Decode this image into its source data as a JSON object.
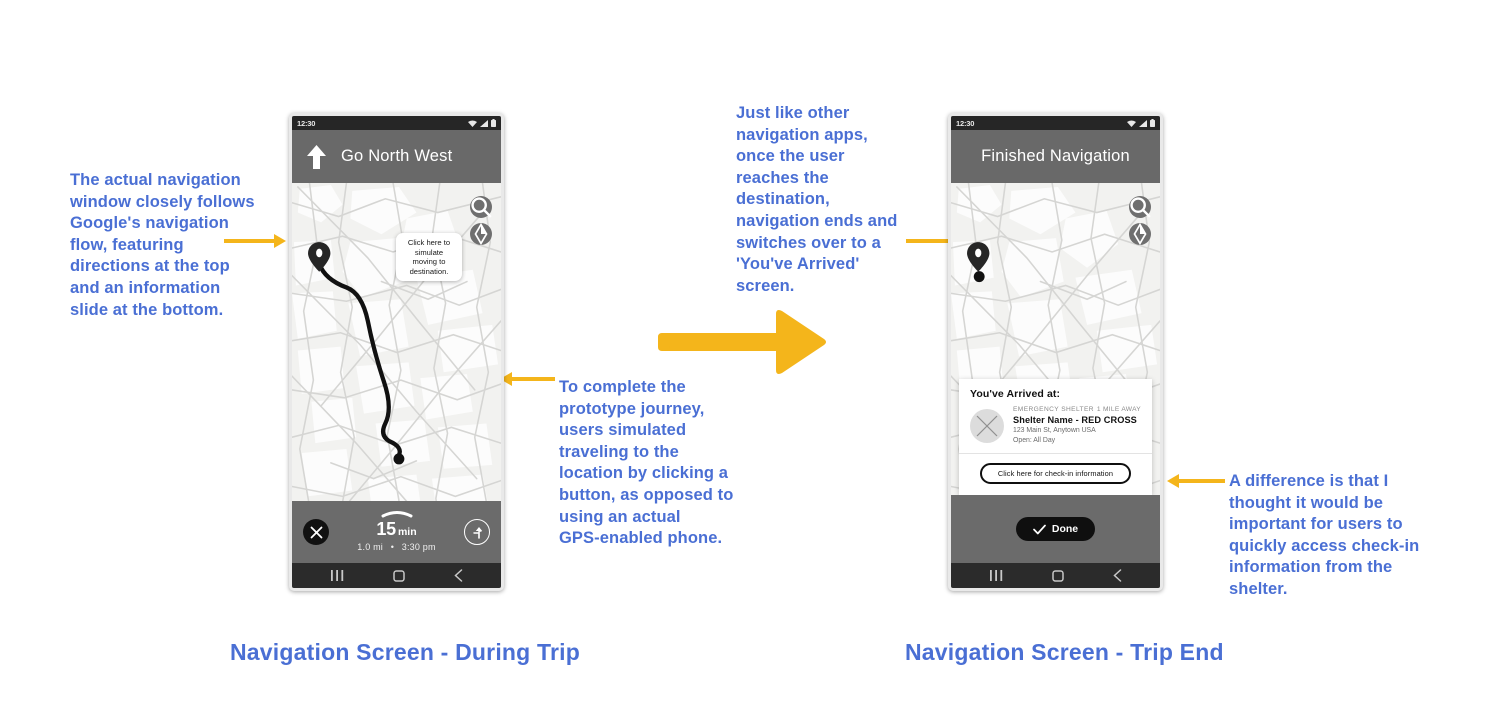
{
  "colors": {
    "annotation_blue": "#4a6fd4",
    "arrow_yellow": "#F4B51B",
    "app_bar_gray": "#696969",
    "status_bar": "#262626",
    "map_bg": "#f2f2f0",
    "route_black": "#111111"
  },
  "annotations": [
    {
      "id": "left-note",
      "text": "The actual navigation\nwindow closely follows\nGoogle's navigation\nflow, featuring\ndirections at the top\nand an information\nslide at the bottom."
    },
    {
      "id": "center-note",
      "text": "Just like other\nnavigation apps,\nonce the user\nreaches the\ndestination,\nnavigation ends and\nswitches over to a\n'You've Arrived'\nscreen."
    },
    {
      "id": "simulate-note",
      "text": "To complete the\nprototype journey,\nusers simulated\ntraveling to the\nlocation by clicking a\nbutton, as opposed to\nusing an actual\nGPS-enabled phone."
    },
    {
      "id": "checkin-note",
      "text": "A difference is that I\nthought it would be\nimportant for users to\nquickly access check-in\ninformation from the\nshelter."
    }
  ],
  "captions": {
    "left": "Navigation Screen - During Trip",
    "right": "Navigation Screen - Trip End"
  },
  "phone_left": {
    "status": {
      "time": "12:30",
      "wifi": "wifi-icon",
      "signal": "signal-icon",
      "battery": "battery-icon"
    },
    "app_bar": {
      "direction_icon": "arrow-up-icon",
      "title": "Go North West"
    },
    "map": {
      "search_icon": "search-icon",
      "compass_icon": "compass-icon",
      "origin_marker": "map-pin-icon",
      "current_dot": "current-location-dot"
    },
    "tooltip": "Click here to simulate moving to destination.",
    "info_slide": {
      "grabber": "drag-handle",
      "eta_value": "15",
      "eta_unit": "min",
      "distance": "1.0 mi",
      "separator": "•",
      "arrival_time": "3:30 pm",
      "close_icon": "close-icon",
      "directions_icon": "directions-icon"
    },
    "nav_bar": {
      "recents": "recents-icon",
      "home": "home-icon",
      "back": "back-icon"
    }
  },
  "phone_right": {
    "status": {
      "time": "12:30",
      "wifi": "wifi-icon",
      "signal": "signal-icon",
      "battery": "battery-icon"
    },
    "app_bar": {
      "title": "Finished Navigation"
    },
    "map": {
      "search_icon": "search-icon",
      "compass_icon": "compass-icon",
      "destination_marker": "map-pin-icon",
      "current_dot": "current-location-dot"
    },
    "arrived_card": {
      "heading": "You've Arrived at:",
      "thumbnail": "placeholder-image-icon",
      "category": "EMERGENCY SHELTER",
      "distance_away": "1 MILE AWAY",
      "name": "Shelter Name - RED CROSS",
      "address": "123 Main St, Anytown USA",
      "hours": "Open: All Day",
      "cta_label": "Click here for check-in information"
    },
    "done_bar": {
      "check_icon": "check-icon",
      "label": "Done"
    },
    "nav_bar": {
      "recents": "recents-icon",
      "home": "home-icon",
      "back": "back-icon"
    }
  }
}
